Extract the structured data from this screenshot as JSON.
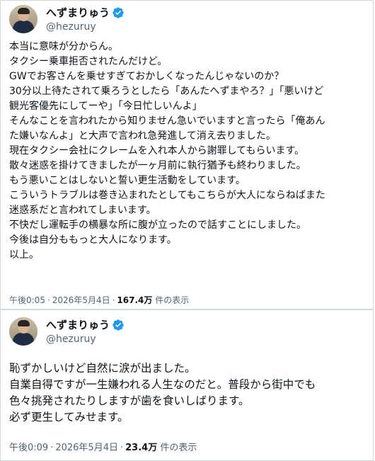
{
  "tweets": [
    {
      "author": {
        "display_name": "へずまりゅう",
        "handle": "@hezuruy"
      },
      "lines": [
        "本当に意味が分からん。",
        "タクシー乗車拒否されたんだけど。",
        "GWでお客さんを乗せすぎておかしくなったんじゃないのか？",
        "30分以上待たされて乗ろうとしたら「あんたへずまやろ？」「悪いけど",
        "観光客優先にしてーや」「今日忙しいんよ」",
        "そんなことを言われたから知りません急いでいますと言ったら「俺あん",
        "た嫌いなんよ」と大声で言われ急発進して消え去りました。",
        "現在タクシー会社にクレームを入れ本人から謝罪してもらいます。",
        "散々迷惑を掛けてきましたが一ヶ月前に執行猶予も終わりました。",
        "もう悪いことはしないと誓い更生活動をしています。",
        "こういうトラブルは巻き込まれたとしてもこちらが大人にならねばまた",
        "迷惑系だと言われてしまいます。",
        "不快だし運転手の横暴な所に腹が立ったので話すことにしました。",
        "今後は自分ももっと大人になります。",
        "以上。"
      ],
      "time": "午後0:05",
      "date": "2026年5月4日",
      "views_count": "167.4万",
      "views_label": "件の表示"
    },
    {
      "author": {
        "display_name": "へずまりゅう",
        "handle": "@hezuruy"
      },
      "lines": [
        "恥ずかしいけど自然に涙が出ました。",
        "自業自得ですが一生嫌われる人生なのだと。普段から街中でも",
        "色々挑発されたりしますが歯を食いしばります。",
        "必ず更生してみせます。"
      ],
      "time": "午後0:09",
      "date": "2026年5月4日",
      "views_count": "23.4万",
      "views_label": "件の表示"
    }
  ],
  "meta_separator": "·",
  "colors": {
    "verified": "#1d9bf0",
    "text": "#0f1419",
    "secondary": "#536471",
    "border": "#cfd9de"
  },
  "icons": {
    "verified": "verified-badge-icon",
    "avatar": "profile-photo"
  }
}
